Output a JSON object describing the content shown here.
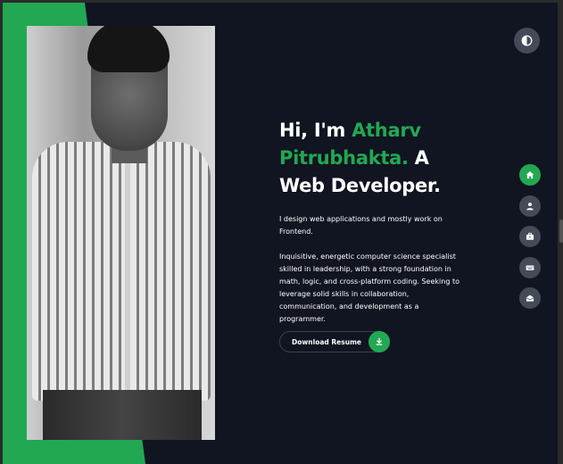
{
  "theme_toggle": {
    "icon": "contrast-icon"
  },
  "hero": {
    "greeting": "Hi, I'm ",
    "name_line1": "Atharv",
    "name_line2": "Pitrubhakta.",
    "suffix": " A",
    "role": "Web Developer.",
    "intro": "I design web applications and mostly work on Frontend.",
    "about": "Inquisitive, energetic computer science specialist skilled in leadership, with a strong foundation in math, logic, and cross-platform coding. Seeking to leverage solid skills in collaboration, communication, and development as a programmer."
  },
  "resume_button": {
    "label": "Download Resume",
    "icon": "download-icon"
  },
  "nav": [
    {
      "icon": "home-icon",
      "active": true
    },
    {
      "icon": "user-icon",
      "active": false
    },
    {
      "icon": "briefcase-icon",
      "active": false
    },
    {
      "icon": "keyboard-icon",
      "active": false
    },
    {
      "icon": "contact-icon",
      "active": false
    }
  ],
  "colors": {
    "accent": "#22a853",
    "background": "#111421",
    "nav_inactive": "#454a58",
    "text": "#ffffff"
  }
}
